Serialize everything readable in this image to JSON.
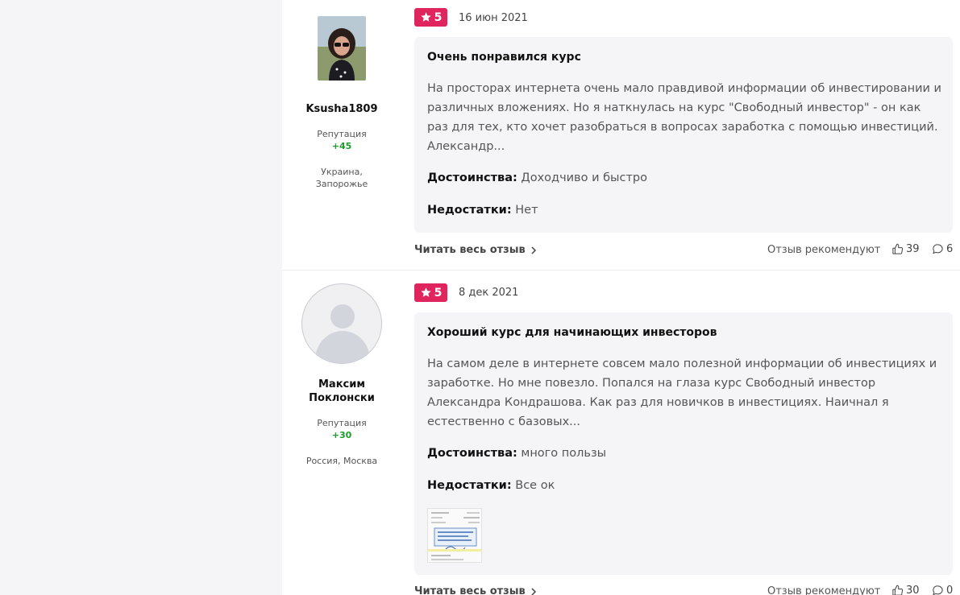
{
  "reviews": [
    {
      "author": {
        "name": "Ksusha1809",
        "reputation_label": "Репутация",
        "reputation_value": "+45",
        "location_line1": "Украина,",
        "location_line2": "Запорожье",
        "avatar": "user-photo"
      },
      "rating": "5",
      "date": "16 июн 2021",
      "title": "Очень понравился курс",
      "text": "На просторах интернета очень мало правдивой информации об инвестировании и различных вложениях. Но я наткнулась на курс \"Свободный инвестор\" - он как раз для тех, кто хочет разобраться в вопросах заработка с помощью инвестиций. Александр...",
      "pros_label": "Достоинства:",
      "pros": "Доходчиво и быстро",
      "cons_label": "Недостатки:",
      "cons": "Нет",
      "read_more": "Читать весь отзыв",
      "recommend_label": "Отзыв рекомендуют",
      "likes": "39",
      "comments": "6"
    },
    {
      "author": {
        "name_line1": "Максим",
        "name_line2": "Поклонски",
        "reputation_label": "Репутация",
        "reputation_value": "+30",
        "location": "Россия, Москва",
        "avatar": "default-avatar"
      },
      "rating": "5",
      "date": "8 дек 2021",
      "title": "Хороший курс для начинающих инвесторов",
      "text": "На самом деле в интернете совсем мало полезной информации об инвестициях и заработке. Но мне повезло. Попался на глаза курс Свободный инвестор Александра Кондрашова. Как раз для новичков в инвестициях. Наичнал я естественно с базовых...",
      "pros_label": "Достоинства:",
      "pros": "много пользы",
      "cons_label": "Недостатки:",
      "cons": "Все ок",
      "read_more": "Читать весь отзыв",
      "recommend_label": "Отзыв рекомендуют",
      "likes": "30",
      "comments": "0"
    }
  ],
  "colors": {
    "badge": "#e0245e",
    "reputation": "#1a9e2a",
    "card_bg": "#f5f5f7"
  },
  "icons": {
    "rating": "star-icon",
    "more": "chevron-right-icon",
    "like": "thumbs-up-icon",
    "comment": "comment-icon"
  }
}
